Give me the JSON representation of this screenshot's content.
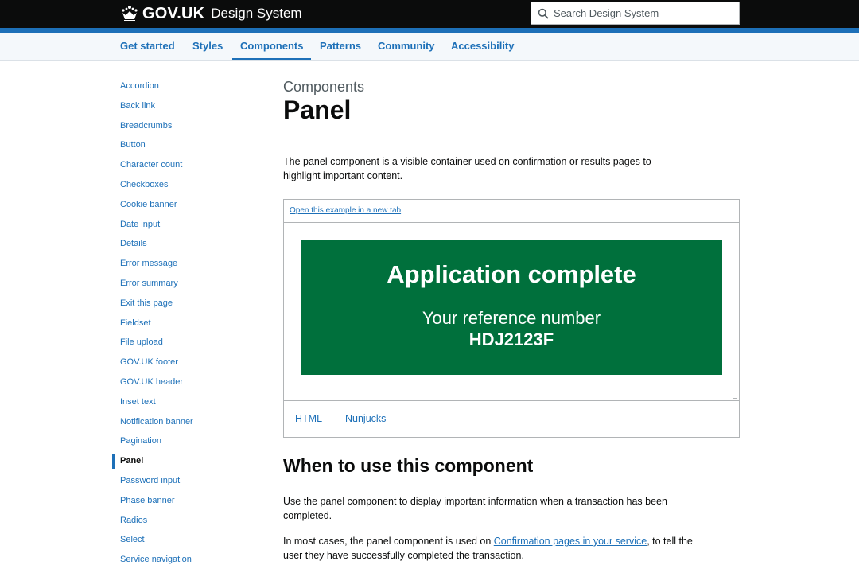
{
  "header": {
    "logo_text": "GOV.UK",
    "product_name": "Design System",
    "search_placeholder": "Search Design System"
  },
  "nav": {
    "items": [
      {
        "label": "Get started"
      },
      {
        "label": "Styles"
      },
      {
        "label": "Components",
        "active": true
      },
      {
        "label": "Patterns"
      },
      {
        "label": "Community"
      },
      {
        "label": "Accessibility"
      }
    ]
  },
  "sidebar": {
    "items": [
      {
        "label": "Accordion"
      },
      {
        "label": "Back link"
      },
      {
        "label": "Breadcrumbs"
      },
      {
        "label": "Button"
      },
      {
        "label": "Character count"
      },
      {
        "label": "Checkboxes"
      },
      {
        "label": "Cookie banner"
      },
      {
        "label": "Date input"
      },
      {
        "label": "Details"
      },
      {
        "label": "Error message"
      },
      {
        "label": "Error summary"
      },
      {
        "label": "Exit this page"
      },
      {
        "label": "Fieldset"
      },
      {
        "label": "File upload"
      },
      {
        "label": "GOV.UK footer"
      },
      {
        "label": "GOV.UK header"
      },
      {
        "label": "Inset text"
      },
      {
        "label": "Notification banner"
      },
      {
        "label": "Pagination"
      },
      {
        "label": "Panel",
        "active": true
      },
      {
        "label": "Password input"
      },
      {
        "label": "Phase banner"
      },
      {
        "label": "Radios"
      },
      {
        "label": "Select"
      },
      {
        "label": "Service navigation"
      }
    ]
  },
  "main": {
    "caption": "Components",
    "title": "Panel",
    "intro": "The panel component is a visible container used on confirmation or results pages to highlight important content.",
    "example": {
      "open_link": "Open this example in a new tab",
      "panel_title": "Application complete",
      "panel_body": "Your reference number",
      "panel_ref": "HDJ2123F",
      "tabs": [
        "HTML",
        "Nunjucks"
      ]
    },
    "section_heading": "When to use this component",
    "para1": "Use the panel component to display important information when a transaction has been completed.",
    "para2_before": "In most cases, the panel component is used on ",
    "para2_link": "Confirmation pages in your service",
    "para2_after": ", to tell the user they have successfully completed the transaction."
  },
  "colors": {
    "header_bg": "#0b0c0c",
    "brand_blue": "#1d70b8",
    "panel_green": "#00703c",
    "nav_bg": "#f4f8fb"
  }
}
